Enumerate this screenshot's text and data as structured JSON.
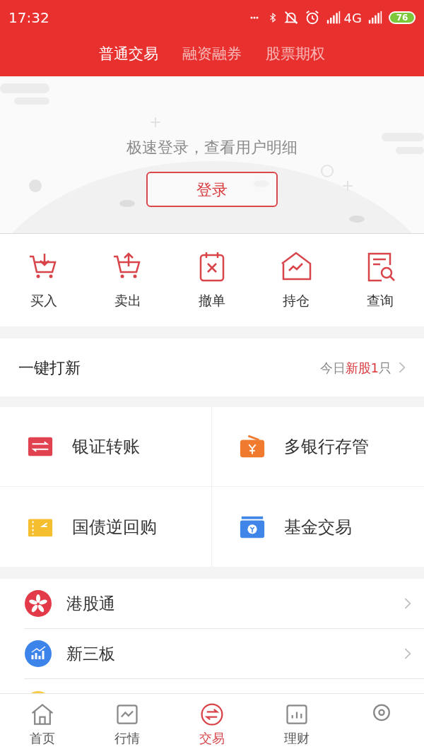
{
  "status_bar": {
    "time": "17:32",
    "battery": "76",
    "network": "4G"
  },
  "tabs": [
    {
      "label": "普通交易",
      "selected": true
    },
    {
      "label": "融资融券",
      "selected": false
    },
    {
      "label": "股票期权",
      "selected": false
    }
  ],
  "login": {
    "prompt": "极速登录，查看用户明细",
    "button": "登录"
  },
  "actions": [
    {
      "label": "买入",
      "kind": "buy"
    },
    {
      "label": "卖出",
      "kind": "sell"
    },
    {
      "label": "撤单",
      "kind": "cancel"
    },
    {
      "label": "持仓",
      "kind": "holdings"
    },
    {
      "label": "查询",
      "kind": "query"
    }
  ],
  "ipo": {
    "title": "一键打新",
    "hint": [
      {
        "text": "今日",
        "highlight": false
      },
      {
        "text": "新股1",
        "highlight": true
      },
      {
        "text": "只",
        "highlight": false
      }
    ]
  },
  "services": [
    {
      "label": "银证转账",
      "kind": "transfer",
      "color": "#e0434f"
    },
    {
      "label": "多银行存管",
      "kind": "bank",
      "color": "#f07a2e"
    },
    {
      "label": "国债逆回购",
      "kind": "repo",
      "color": "#f5be2e"
    },
    {
      "label": "基金交易",
      "kind": "fund",
      "color": "#3f86e8"
    }
  ],
  "markets": [
    {
      "label": "港股通",
      "kind": "hk",
      "color": "#e23a48"
    },
    {
      "label": "新三板",
      "kind": "neeq",
      "color": "#3d84ea"
    }
  ],
  "bottom_nav": [
    {
      "label": "首页",
      "kind": "home",
      "selected": false
    },
    {
      "label": "行情",
      "kind": "market",
      "selected": false
    },
    {
      "label": "交易",
      "kind": "trade",
      "selected": true
    },
    {
      "label": "理财",
      "kind": "finance",
      "selected": false
    },
    {
      "kind": "profile",
      "selected": false
    }
  ]
}
